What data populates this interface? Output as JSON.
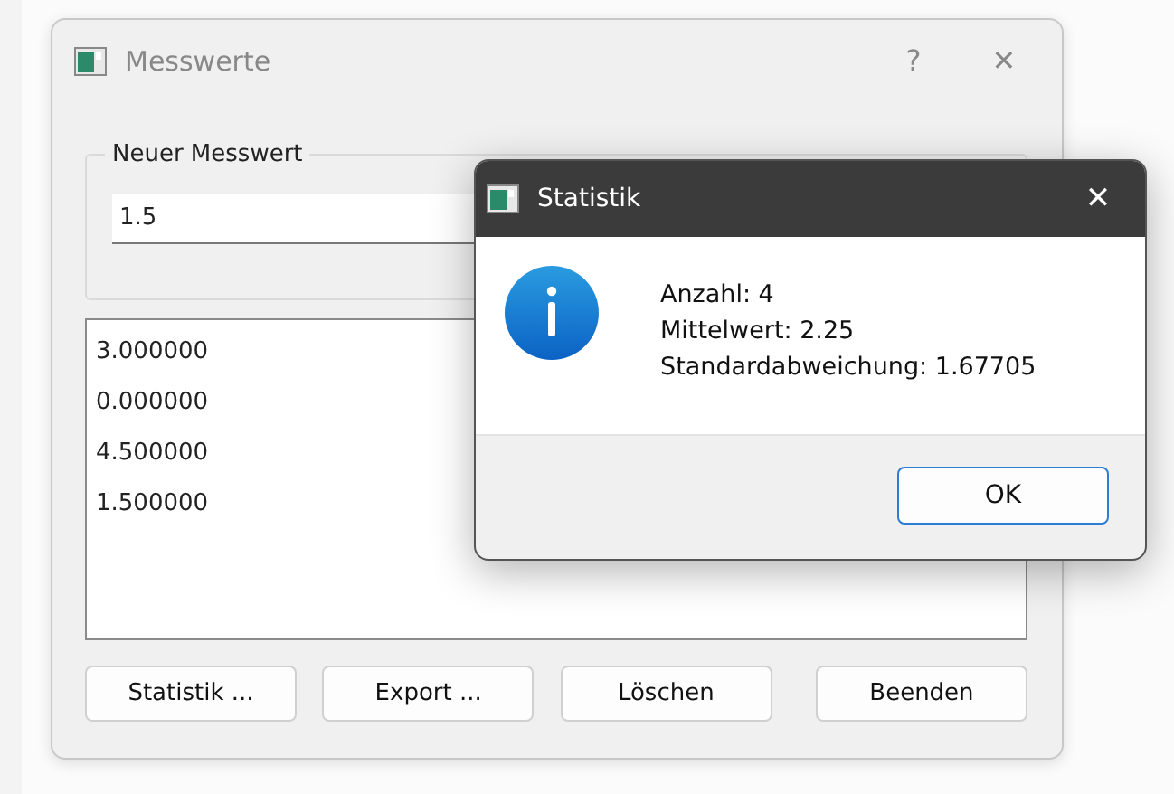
{
  "main_window": {
    "title": "Messwerte",
    "help_button": "?",
    "close_button": "✕"
  },
  "group": {
    "title": "Neuer Messwert",
    "input": {
      "value": "1.5"
    }
  },
  "list": {
    "items": [
      "3.000000",
      "0.000000",
      "4.500000",
      "1.500000"
    ]
  },
  "buttons": [
    "Statistik ...",
    "Export ...",
    "Löschen",
    "Beenden"
  ],
  "dialog": {
    "title": "Statistik",
    "close_button": "✕",
    "lines": [
      "Anzahl: 4",
      "Mittelwert: 2.25",
      "Standardabweichung: 1.67705"
    ],
    "button": "OK"
  }
}
